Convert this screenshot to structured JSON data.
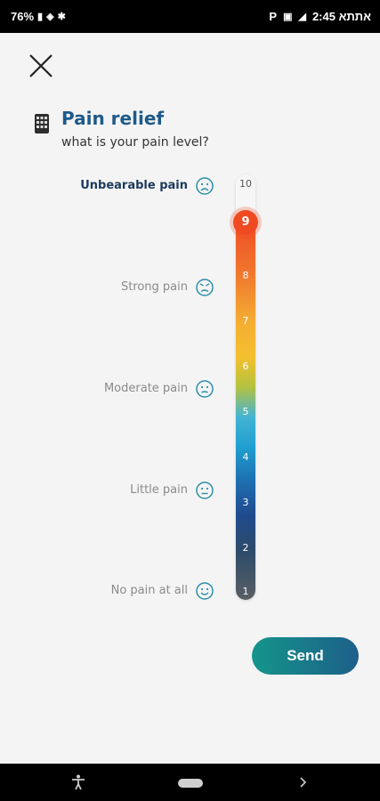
{
  "status_bar": {
    "battery": "76%",
    "time_carrier": "אתתא 2:45",
    "icons": [
      "battery-icon",
      "wifi-icon",
      "bluetooth-icon",
      "parking-icon",
      "vibrate-icon",
      "signal-icon"
    ]
  },
  "header": {
    "title": "Pain relief",
    "subtitle": "what is your pain level?",
    "icon": "phone-grid-icon"
  },
  "pain_levels": [
    {
      "label": "Unbearable pain",
      "icon": "sad-face-icon",
      "selected": true
    },
    {
      "label": "Strong pain",
      "icon": "angry-face-icon"
    },
    {
      "label": "Moderate pain",
      "icon": "frown-face-icon"
    },
    {
      "label": "Little pain",
      "icon": "neutral-face-icon"
    },
    {
      "label": "No pain at all",
      "icon": "smile-face-icon"
    }
  ],
  "scale": {
    "numbers": [
      "10",
      "9",
      "8",
      "7",
      "6",
      "5",
      "4",
      "3",
      "2",
      "1"
    ],
    "selected": "9",
    "max": 10,
    "min": 1
  },
  "actions": {
    "send_label": "Send"
  },
  "colors": {
    "title": "#1d5a8a",
    "send_gradient_start": "#14958b",
    "send_gradient_end": "#1d5f8a",
    "selected_knob": "#f04a23"
  }
}
